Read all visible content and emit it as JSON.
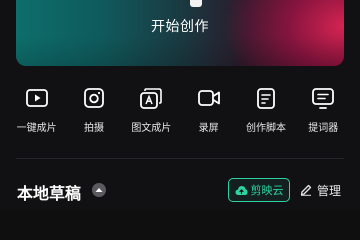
{
  "banner": {
    "label": "开始创作"
  },
  "tools": [
    {
      "label": "一键成片",
      "icon": "play-video-icon"
    },
    {
      "label": "拍摄",
      "icon": "camera-icon"
    },
    {
      "label": "图文成片",
      "icon": "text-to-video-icon"
    },
    {
      "label": "录屏",
      "icon": "screen-record-icon"
    },
    {
      "label": "创作脚本",
      "icon": "script-document-icon"
    },
    {
      "label": "提词器",
      "icon": "teleprompter-icon"
    }
  ],
  "drafts": {
    "title": "本地草稿",
    "cloud_label": "剪映云",
    "manage_label": "管理"
  },
  "colors": {
    "accent": "#2fd3a0",
    "background": "#111113",
    "banner_left": "#0d6e6b",
    "banner_right": "#e8285a"
  }
}
